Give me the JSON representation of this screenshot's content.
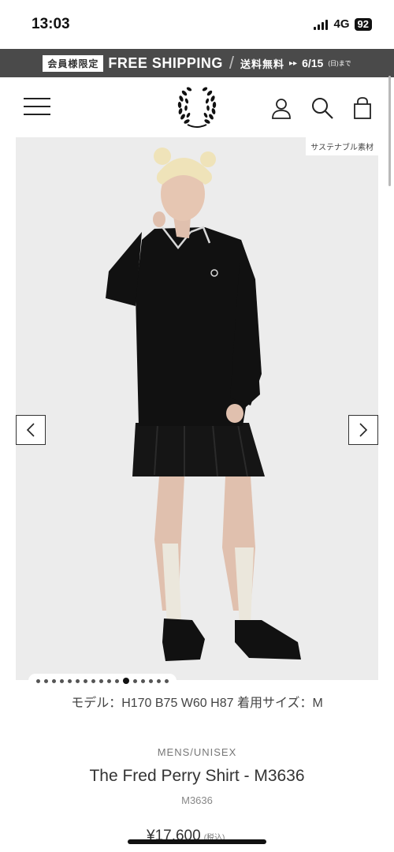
{
  "status_bar": {
    "time": "13:03",
    "network": "4G",
    "battery": "92"
  },
  "promo": {
    "badge": "会員様限定",
    "main": "FREE SHIPPING",
    "sub": "送料無料",
    "arrow": "▸▸",
    "date": "6/15",
    "date_note": "(日)まで"
  },
  "header": {
    "menu_icon": "hamburger-menu-icon",
    "logo": "laurel-wreath-logo",
    "account_icon": "user-icon",
    "search_icon": "search-icon",
    "cart_icon": "shopping-bag-icon"
  },
  "product": {
    "sustain_tag": "サステナブル素材",
    "image_count": 17,
    "active_image": 12,
    "model_info": "モデル：H170 B75 W60 H87 着用サイズ：M",
    "category": "MENS/UNISEX",
    "title": "The Fred Perry Shirt - M3636",
    "code": "M3636",
    "price": "¥17,600",
    "tax_note": "(税込)"
  },
  "colors": {
    "banner_bg": "#4a4a4a",
    "image_bg": "#ececec",
    "shirt": "#111111",
    "tipping": "#d9d9d9"
  }
}
